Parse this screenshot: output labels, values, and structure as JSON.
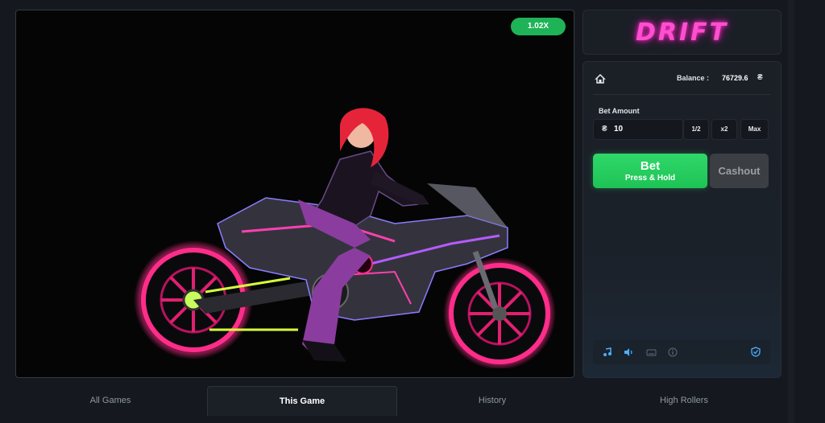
{
  "game": {
    "multiplier": "1.02X",
    "scene": "rider-on-neon-motorcycle"
  },
  "logo": {
    "text": "DRIFT"
  },
  "panel": {
    "balance_label": "Balance :",
    "balance_value": "76729.6",
    "currency_icon": "coin-icon",
    "bet_amount_label": "Bet Amount",
    "bet_amount_value": "10",
    "half_label": "1/2",
    "double_label": "x2",
    "max_label": "Max",
    "bet_button_label": "Bet",
    "bet_button_sub": "Press & Hold",
    "cashout_label": "Cashout",
    "footer_icons": [
      "music-icon",
      "volume-icon",
      "keyboard-icon",
      "info-icon",
      "shield-icon"
    ]
  },
  "tabs": [
    {
      "label": "All Games",
      "active": false
    },
    {
      "label": "This Game",
      "active": true
    },
    {
      "label": "History",
      "active": false
    },
    {
      "label": "High Rollers",
      "active": false
    }
  ],
  "colors": {
    "accent_green": "#1fb357",
    "logo_pink": "#ff4fd0",
    "neon_pink": "#ff2d8a",
    "icon_blue": "#4ab0ff"
  }
}
